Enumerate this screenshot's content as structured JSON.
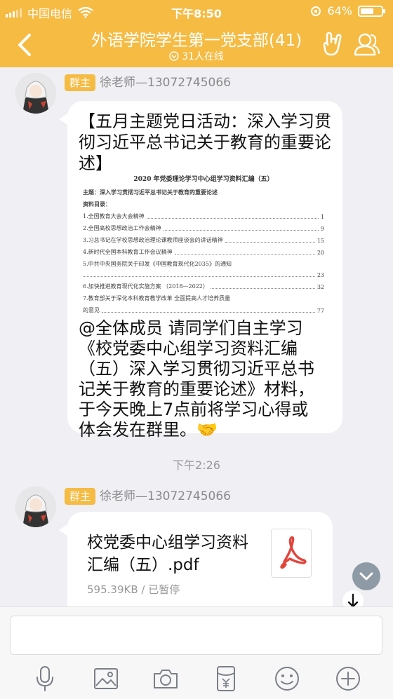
{
  "status": {
    "carrier": "中国电信",
    "time": "下午8:50",
    "battery": "64%",
    "battery_level": 0.64
  },
  "header": {
    "title": "外语学院学生第一党支部(41)",
    "online": "31人在线"
  },
  "messages": [
    {
      "role": "群主",
      "sender": "徐老师—13072745066",
      "title": "【五月主题党日活动：深入学习贯彻习近平总书记关于教育的重要论述】",
      "doc": {
        "title": "2020 年党委理论学习中心组学习资料汇编（五）",
        "topic": "主题：深入学习贯彻习近平总书记关于教育的重要论述",
        "toc_heading": "资料目录：",
        "toc": [
          {
            "text": "1.全国教育大会大会精神",
            "page": "1"
          },
          {
            "text": "2.全国高校思想政治工作会精神",
            "page": "9"
          },
          {
            "text": "3.习总书记在学校思想政治理论课教师座谈会的讲话精神",
            "page": "15"
          },
          {
            "text": "4.新时代全国本科教育工作会议精神",
            "page": "20"
          },
          {
            "text": "5.中共中央国务院关于印发《中国教育现代化2035》的通知",
            "page": ""
          },
          {
            "text": "",
            "page": "23"
          },
          {
            "text": "6.加快推进教育现代化实施方案 （2018—2022）",
            "page": "32"
          },
          {
            "text": "7.教育部关于深化本科教育教学改革 全面提高人才培养质量",
            "page": ""
          },
          {
            "text": "的意见",
            "page": "77"
          }
        ]
      },
      "body_line1": "@全体成员  请同学们自主学习",
      "body_line2": "《校党委中心组学习资料汇编",
      "body_line3": "（五）深入学习贯彻习近平总书",
      "body_line4": "记关于教育的重要论述》材料，",
      "body_line5": "于今天晚上7点前将学习心得或",
      "body_line6": "体会发在群里。🤝"
    }
  ],
  "timestamp": "下午2:26",
  "file_message": {
    "role": "群主",
    "sender": "徐老师—13072745066",
    "file_name": "校党委中心组学习资料汇编（五）.pdf",
    "file_meta": "595.39KB / 已暂停"
  },
  "icons": {
    "back": "chevron-left-icon",
    "hand": "rock-hand-icon",
    "people": "group-members-icon",
    "voice": "microphone-icon",
    "image": "image-icon",
    "camera": "camera-icon",
    "redpacket": "red-packet-icon",
    "emoji": "emoji-icon",
    "plus": "plus-icon"
  },
  "colors": {
    "accent": "#f5bb43",
    "background": "#efeff4",
    "pdf_red": "#e2453c"
  }
}
